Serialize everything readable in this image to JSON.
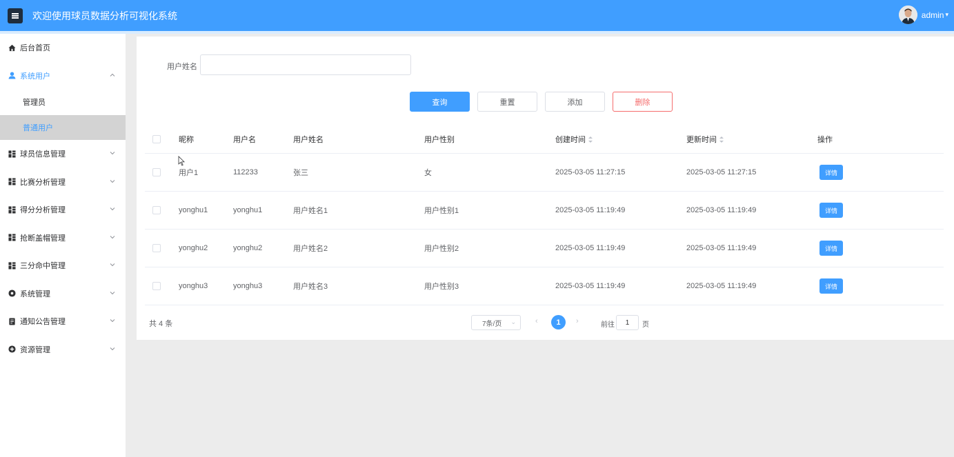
{
  "header": {
    "title": "欢迎使用球员数据分析可视化系统",
    "username": "admin"
  },
  "sidebar": {
    "items": [
      {
        "label": "后台首页",
        "icon": "home-icon"
      },
      {
        "label": "系统用户",
        "icon": "user-icon",
        "expanded": true,
        "children": [
          {
            "label": "管理员"
          },
          {
            "label": "普通用户",
            "selected": true
          }
        ]
      },
      {
        "label": "球员信息管理",
        "icon": "grid-icon"
      },
      {
        "label": "比赛分析管理",
        "icon": "grid-icon"
      },
      {
        "label": "得分分析管理",
        "icon": "grid-icon"
      },
      {
        "label": "抢断盖帽管理",
        "icon": "grid-icon"
      },
      {
        "label": "三分命中管理",
        "icon": "grid-icon"
      },
      {
        "label": "系统管理",
        "icon": "gear-icon"
      },
      {
        "label": "通知公告管理",
        "icon": "notice-icon"
      },
      {
        "label": "资源管理",
        "icon": "plus-circle-icon"
      }
    ]
  },
  "search": {
    "label": "用户姓名",
    "value": ""
  },
  "buttons": {
    "query": "查询",
    "reset": "重置",
    "add": "添加",
    "delete": "删除"
  },
  "table": {
    "headers": [
      "昵称",
      "用户名",
      "用户姓名",
      "用户性别",
      "创建时间",
      "更新时间",
      "操作"
    ],
    "rows": [
      {
        "nickname": "用户1",
        "username": "112233",
        "realname": "张三",
        "gender": "女",
        "created": "2025-03-05 11:27:15",
        "updated": "2025-03-05 11:27:15",
        "action": "详情"
      },
      {
        "nickname": "yonghu1",
        "username": "yonghu1",
        "realname": "用户姓名1",
        "gender": "用户性别1",
        "created": "2025-03-05 11:19:49",
        "updated": "2025-03-05 11:19:49",
        "action": "详情"
      },
      {
        "nickname": "yonghu2",
        "username": "yonghu2",
        "realname": "用户姓名2",
        "gender": "用户性别2",
        "created": "2025-03-05 11:19:49",
        "updated": "2025-03-05 11:19:49",
        "action": "详情"
      },
      {
        "nickname": "yonghu3",
        "username": "yonghu3",
        "realname": "用户姓名3",
        "gender": "用户性别3",
        "created": "2025-03-05 11:19:49",
        "updated": "2025-03-05 11:19:49",
        "action": "详情"
      }
    ]
  },
  "pagination": {
    "total": "共 4 条",
    "page_size": "7条/页",
    "prev": "‹",
    "next": "›",
    "current": "1",
    "goto_prefix": "前往",
    "goto_value": "1",
    "goto_suffix": "页"
  },
  "colors": {
    "primary": "#409eff",
    "danger": "#f56c6c",
    "sidebar_selected": "#d3d3d3"
  }
}
